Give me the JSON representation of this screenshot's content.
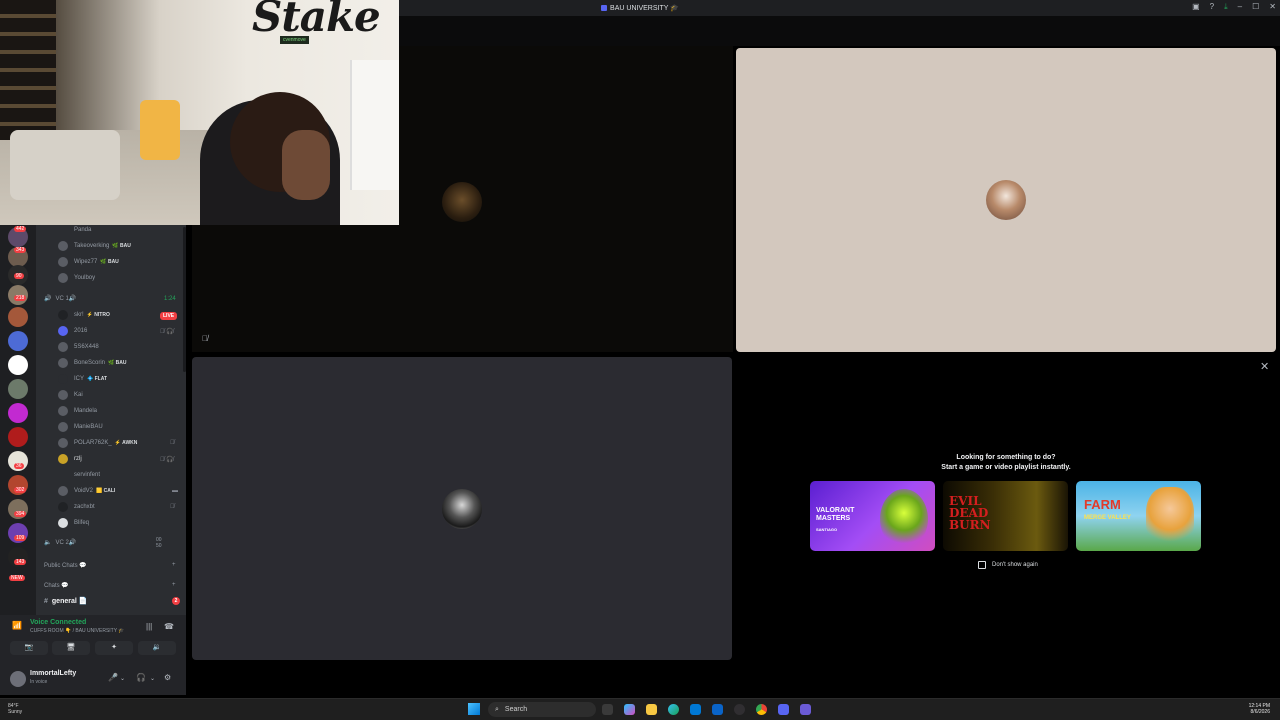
{
  "window": {
    "title": "BAU UNIVERSITY 🎓"
  },
  "webcam": {
    "brand": "Stake",
    "sign": "cvenmove"
  },
  "rail": {
    "badges": [
      "442",
      "343",
      "90",
      "218",
      "36",
      "302",
      "394",
      "109",
      "143",
      "NEW"
    ]
  },
  "channels": {
    "members_top": [
      {
        "name": "Panda",
        "tag": ""
      },
      {
        "name": "Takeoverking",
        "tag": "🌿 BAU"
      },
      {
        "name": "Wipez77",
        "tag": "🌿 BAU"
      },
      {
        "name": "Youlboy",
        "tag": ""
      }
    ],
    "vc1": {
      "label": "VC 1🔊",
      "timer": "1:24"
    },
    "vc1_members": [
      {
        "name": "skr!",
        "tag": "⚡ NITRO",
        "icons": ""
      },
      {
        "name": "2016",
        "tag": "",
        "icons": "🎙̸ 🎧̸"
      },
      {
        "name": "5S6X448",
        "tag": "",
        "icons": ""
      },
      {
        "name": "BoneScorin",
        "tag": "🌿 BAU",
        "icons": ""
      },
      {
        "name": "ICY",
        "tag": "💠 FLAT",
        "icons": ""
      },
      {
        "name": "Kai",
        "tag": "",
        "icons": ""
      },
      {
        "name": "Mandela",
        "tag": "",
        "icons": ""
      },
      {
        "name": "ManieBAU",
        "tag": "",
        "icons": ""
      },
      {
        "name": "POLAR762K_",
        "tag": "⚡ AWKN",
        "icons": "🎙̸"
      },
      {
        "name": "rzlj",
        "tag": "",
        "icons": "🎙̸ 🎧̸"
      },
      {
        "name": "servinfent",
        "tag": "",
        "icons": ""
      },
      {
        "name": "VoidV2",
        "tag": "🟨 CALI",
        "icons": "▬"
      },
      {
        "name": "zachxbt",
        "tag": "",
        "icons": "🎙̸"
      },
      {
        "name": "Blifeq",
        "tag": "",
        "icons": ""
      }
    ],
    "live_label": "LIVE",
    "vc2": {
      "label": "VC 2🔊",
      "counts": "00 50"
    },
    "categories": {
      "public": "Public Chats 💬",
      "chats": "Chats 💬"
    },
    "general": {
      "label": "general 📄",
      "count": "2"
    }
  },
  "voice": {
    "status": "Voice Connected",
    "location": "CUFFS ROOM 👇 / BAU UNIVERSITY 🎓"
  },
  "user": {
    "name": "ImmortalLefty",
    "status": "In voice"
  },
  "activity": {
    "heading_line1": "Looking for something to do?",
    "heading_line2": "Start a game or video playlist instantly.",
    "cards": [
      {
        "title": "VALORANT MASTERS",
        "sub": "SANTIAGO",
        "color": "#7b2ff7"
      },
      {
        "title": "EVIL DEAD BURN",
        "sub": "",
        "color": "#1a1200"
      },
      {
        "title": "FARM",
        "sub": "MERGE VALLEY",
        "color": "#4bb3e6"
      }
    ],
    "dont_show": "Don't show again"
  },
  "taskbar": {
    "weather_temp": "84°F",
    "weather_desc": "Sunny",
    "search_placeholder": "Search",
    "time": "12:14 PM",
    "date": "8/6/2026"
  },
  "colors": {
    "accent": "#5865f2",
    "online": "#23a55a",
    "live": "#f23f43"
  }
}
